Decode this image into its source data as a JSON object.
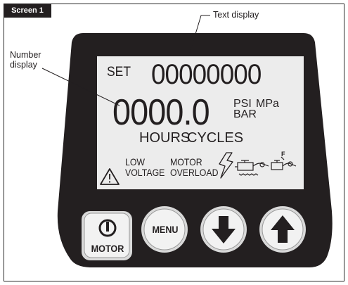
{
  "figure": {
    "tag_label": "Screen 1",
    "callouts": {
      "text_display": "Text display",
      "number_display_line1": "Number",
      "number_display_line2": "display"
    }
  },
  "lcd": {
    "set_label": "SET",
    "top_digits": "00000000",
    "main_digits": "0000.0",
    "units": {
      "psi": "PSI",
      "mpa": "MPa",
      "bar": "BAR"
    },
    "counters": {
      "hours": "HOURS",
      "cycles": "CYCLES"
    },
    "alarms": {
      "low": "LOW",
      "voltage": "VOLTAGE",
      "motor": "MOTOR",
      "overload": "OVERLOAD"
    },
    "pump_flag": "F",
    "icons": [
      "warning-triangle-icon",
      "lightning-icon",
      "pump-icon",
      "pump-f-icon"
    ]
  },
  "buttons": {
    "motor": {
      "label": "MOTOR",
      "icon": "power-icon"
    },
    "menu": {
      "label": "MENU"
    },
    "down": {
      "icon": "down-arrow-icon"
    },
    "up": {
      "icon": "up-arrow-icon"
    }
  },
  "colors": {
    "bezel": "#231f20",
    "lcd_background": "#ececec",
    "button_face": "#f2f2f2",
    "tag_background": "#231f20"
  }
}
